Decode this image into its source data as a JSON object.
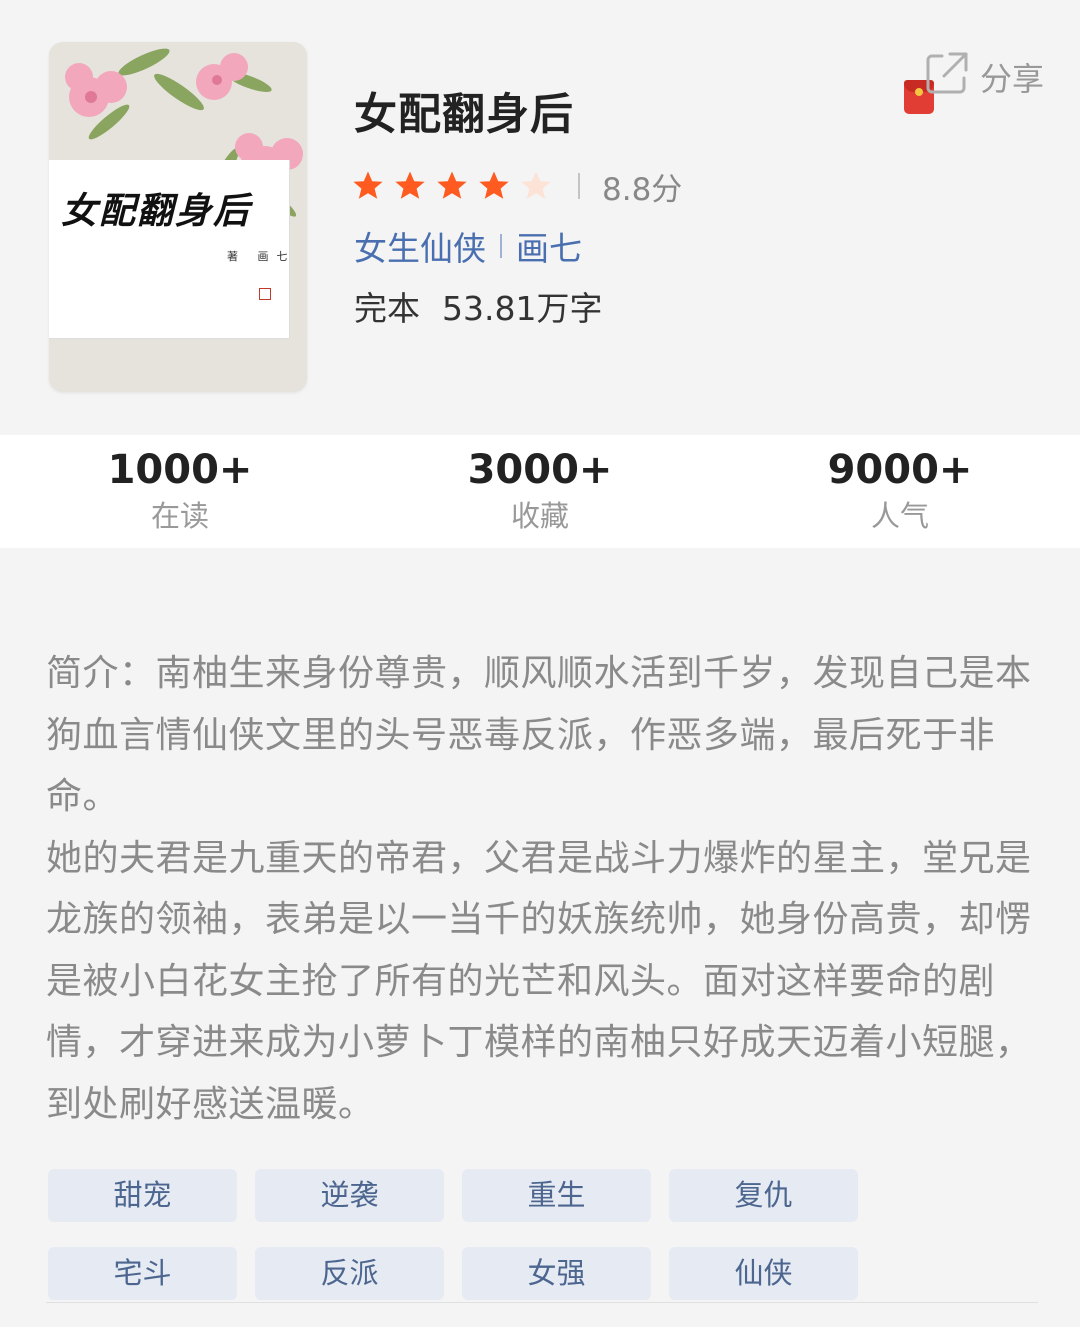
{
  "book": {
    "cover_title": "女配翻身后",
    "cover_author": "著 画七",
    "title": "女配翻身后",
    "rating_stars": 4.5,
    "score": "8.8分",
    "category": "女生仙侠",
    "author": "画七",
    "status": "完本",
    "word_count": "53.81万字"
  },
  "share": {
    "label": "分享",
    "icon": "share-icon",
    "redpacket_icon": "red-packet-icon"
  },
  "stats": [
    {
      "value": "1000+",
      "label": "在读"
    },
    {
      "value": "3000+",
      "label": "收藏"
    },
    {
      "value": "9000+",
      "label": "人气"
    }
  ],
  "intro": {
    "paragraph_1": "简介：南柚生来身份尊贵，顺风顺水活到千岁，发现自己是本狗血言情仙侠文里的头号恶毒反派，作恶多端，最后死于非命。",
    "paragraph_2": "她的夫君是九重天的帝君，父君是战斗力爆炸的星主，堂兄是龙族的领袖，表弟是以一当千的妖族统帅，她身份高贵，却愣是被小白花女主抢了所有的光芒和风头。面对这样要命的剧情，才穿进来成为小萝卜丁模样的南柚只好成天迈着小短腿，到处刷好感送温暖。"
  },
  "tags": [
    "甜宠",
    "逆袭",
    "重生",
    "复仇",
    "宅斗",
    "反派",
    "女强",
    "仙侠"
  ],
  "colors": {
    "star_full": "#ff5a1f",
    "star_empty": "#fde2d6",
    "link": "#4a6fb0",
    "tag_bg": "#e6ebf3",
    "tag_text": "#4d6690"
  }
}
